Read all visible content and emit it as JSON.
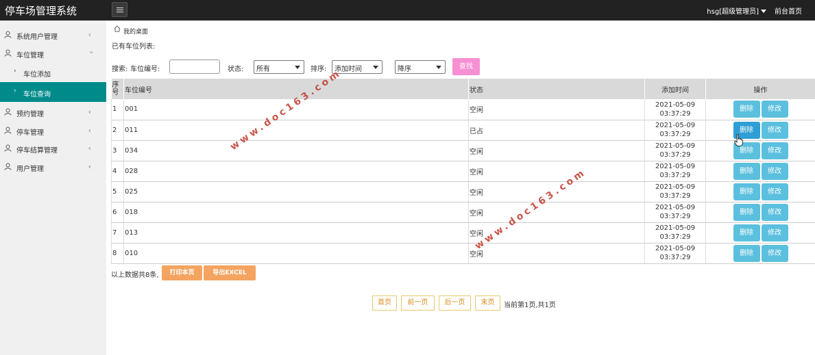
{
  "header": {
    "brand": "停车场管理系统",
    "user": "hsg[超级管理员]",
    "home_link": "前台首页"
  },
  "sidebar": {
    "items": [
      {
        "label": "系统用户管理",
        "icon": "user-icon"
      },
      {
        "label": "车位管理",
        "icon": "user-icon",
        "expanded": true,
        "children": [
          {
            "label": "车位添加"
          },
          {
            "label": "车位查询",
            "active": true
          }
        ]
      },
      {
        "label": "预约管理",
        "icon": "user-icon"
      },
      {
        "label": "停车管理",
        "icon": "user-icon"
      },
      {
        "label": "停车结算管理",
        "icon": "user-icon"
      },
      {
        "label": "用户管理",
        "icon": "user-icon"
      }
    ]
  },
  "breadcrumb": "我的桌面",
  "list_title": "已有车位列表:",
  "search": {
    "prefix": "搜索:",
    "code_label": "车位编号:",
    "code_value": "",
    "status_label": "状态:",
    "status_value": "所有",
    "sort_label": "排序:",
    "sort_field": "添加时间",
    "sort_order": "降序",
    "button": "查找"
  },
  "table": {
    "headers": [
      "序号",
      "车位编号",
      "状态",
      "添加时间",
      "操作"
    ],
    "rows": [
      {
        "no": "1",
        "code": "001",
        "status": "空闲",
        "date": "2021-05-09",
        "time": "03:37:29"
      },
      {
        "no": "2",
        "code": "011",
        "status": "已占",
        "date": "2021-05-09",
        "time": "03:37:29"
      },
      {
        "no": "3",
        "code": "034",
        "status": "空闲",
        "date": "2021-05-09",
        "time": "03:37:29"
      },
      {
        "no": "4",
        "code": "028",
        "status": "空闲",
        "date": "2021-05-09",
        "time": "03:37:29"
      },
      {
        "no": "5",
        "code": "025",
        "status": "空闲",
        "date": "2021-05-09",
        "time": "03:37:29"
      },
      {
        "no": "6",
        "code": "018",
        "status": "空闲",
        "date": "2021-05-09",
        "time": "03:37:29"
      },
      {
        "no": "7",
        "code": "013",
        "status": "空闲",
        "date": "2021-05-09",
        "time": "03:37:29"
      },
      {
        "no": "8",
        "code": "010",
        "status": "空闲",
        "date": "2021-05-09",
        "time": "03:37:29"
      }
    ],
    "delete_label": "删除",
    "edit_label": "修改"
  },
  "footer": {
    "count_text": "以上数据共8条,",
    "print_label": "打印本页",
    "export_label": "导出EXCEL"
  },
  "pagination": {
    "first": "首页",
    "prev": "前一页",
    "next": "后一页",
    "last": "末页",
    "info": "当前第1页,共1页"
  },
  "watermark": "www.doc163.com",
  "colors": {
    "topbar": "#222222",
    "sidebar_active": "#008b8b",
    "search_button": "#f78fd3",
    "op_button": "#5bc0de",
    "orange_button": "#f4a460",
    "pager_text": "#d98c1b"
  }
}
